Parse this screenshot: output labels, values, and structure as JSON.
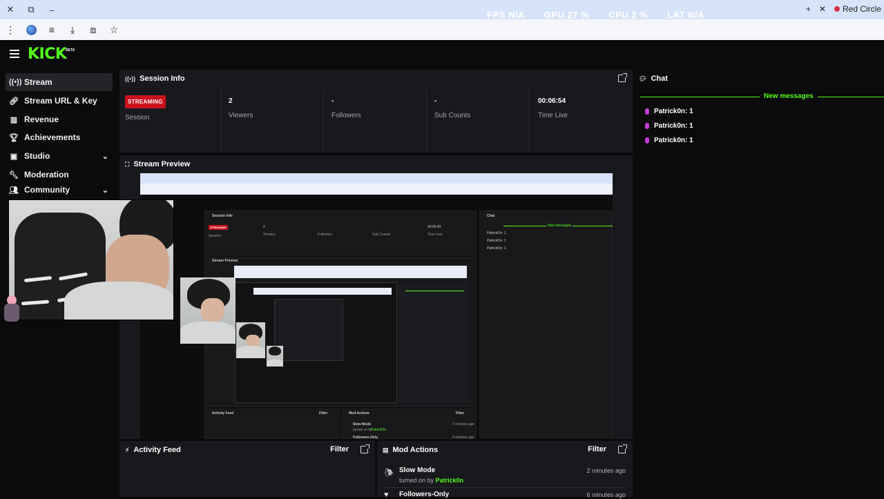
{
  "browser": {
    "stats": [
      "FPS N/A",
      "GPU 27 %",
      "CPU 2 %",
      "LAT N/A"
    ],
    "tab_title": "Red Circle",
    "new_tab_glyph": "+",
    "close_glyph": "✕"
  },
  "app": {
    "logo": "KICK",
    "beta": "BETA"
  },
  "sidebar": {
    "items": [
      {
        "label": "Stream",
        "icon": "broadcast-icon"
      },
      {
        "label": "Stream URL & Key",
        "icon": "link-icon"
      },
      {
        "label": "Revenue",
        "icon": "chart-icon"
      },
      {
        "label": "Achievements",
        "icon": "trophy-icon"
      },
      {
        "label": "Studio",
        "icon": "studio-icon"
      },
      {
        "label": "Moderation",
        "icon": "wrench-icon"
      },
      {
        "label": "Community",
        "icon": "people-icon"
      }
    ]
  },
  "session": {
    "title": "Session Info",
    "badge": "STREAMING",
    "session_label": "Session",
    "stats": [
      {
        "value": "2",
        "label": "Viewers"
      },
      {
        "value": "-",
        "label": "Followers"
      },
      {
        "value": "-",
        "label": "Sub Counts"
      },
      {
        "value": "00:06:54",
        "label": "Time Live"
      }
    ]
  },
  "preview": {
    "title": "Stream Preview",
    "nested": {
      "session_title": "Session Info",
      "badge": "STREAMING",
      "viewers": "2",
      "time": "00:06:49",
      "labels": [
        "Session",
        "Viewers",
        "Followers",
        "Sub Counts",
        "Time Live"
      ],
      "chat_title": "Chat",
      "new_messages": "New messages",
      "messages": [
        "PatrickOn: 1",
        "PatrickOn: 1",
        "PatrickOn: 1"
      ],
      "preview_title": "Stream Preview",
      "activity_title": "Activity Feed",
      "mod_title": "Mod Actions",
      "filter": "Filter",
      "slow_mode": "Slow Mode",
      "turned_on": "turned on by",
      "user": "PatrickOn",
      "followers_only": "Followers-Only",
      "time_ago": "2 minutes ago",
      "time_ago2": "6 minutes ago"
    }
  },
  "chat": {
    "title": "Chat",
    "new_messages": "New messages",
    "messages": [
      {
        "user": "Patrick0n",
        "text": "1"
      },
      {
        "user": "Patrick0n",
        "text": "1"
      },
      {
        "user": "Patrick0n",
        "text": "1"
      }
    ]
  },
  "activity": {
    "title": "Activity Feed",
    "filter": "Filter"
  },
  "mod_actions": {
    "title": "Mod Actions",
    "filter": "Filter",
    "rows": [
      {
        "title": "Slow Mode",
        "sub_prefix": "turned on by",
        "user": "Patrick0n",
        "time": "2 minutes ago"
      },
      {
        "title": "Followers-Only",
        "time": "6 minutes ago"
      }
    ]
  },
  "colors": {
    "accent": "#53fc18",
    "live": "#c9121b",
    "panel": "#18191c",
    "bg": "#0b0b0c"
  }
}
